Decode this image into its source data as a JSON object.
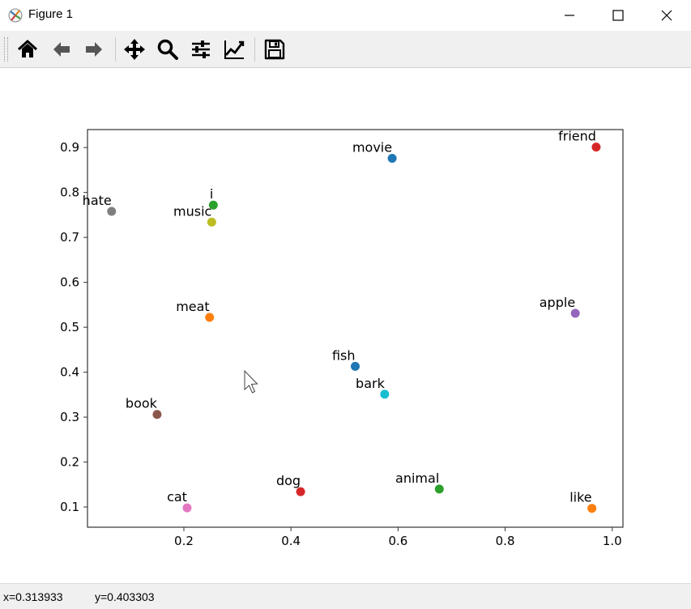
{
  "window": {
    "title": "Figure 1",
    "icons": [
      "figure-app-icon",
      "minimize-icon",
      "maximize-icon",
      "close-icon"
    ]
  },
  "toolbar": {
    "buttons": [
      {
        "name": "home",
        "icon": "home-icon"
      },
      {
        "name": "back",
        "icon": "arrow-left-icon"
      },
      {
        "name": "forward",
        "icon": "arrow-right-icon"
      },
      {
        "name": "pan",
        "icon": "move-icon"
      },
      {
        "name": "zoom",
        "icon": "magnifier-icon"
      },
      {
        "name": "subplots",
        "icon": "sliders-icon"
      },
      {
        "name": "edit-axes",
        "icon": "line-chart-icon"
      },
      {
        "name": "save",
        "icon": "floppy-disk-icon"
      }
    ]
  },
  "status": {
    "x": "x=0.313933",
    "y": "y=0.403303"
  },
  "chart_data": {
    "type": "scatter",
    "title": "",
    "xlabel": "",
    "ylabel": "",
    "xlim": [
      0.02,
      1.02
    ],
    "ylim": [
      0.055,
      0.94
    ],
    "xticks": [
      0.2,
      0.4,
      0.6,
      0.8,
      1.0
    ],
    "xtick_labels": [
      "0.2",
      "0.4",
      "0.6",
      "0.8",
      "1.0"
    ],
    "yticks": [
      0.1,
      0.2,
      0.3,
      0.4,
      0.5,
      0.6,
      0.7,
      0.8,
      0.9
    ],
    "ytick_labels": [
      "0.1",
      "0.2",
      "0.3",
      "0.4",
      "0.5",
      "0.6",
      "0.7",
      "0.8",
      "0.9"
    ],
    "grid": false,
    "points": [
      {
        "label": "movie",
        "x": 0.589,
        "y": 0.876,
        "color": "#1f77b4"
      },
      {
        "label": "friend",
        "x": 0.97,
        "y": 0.901,
        "color": "#d62728"
      },
      {
        "label": "hate",
        "x": 0.065,
        "y": 0.758,
        "color": "#7f7f7f"
      },
      {
        "label": "i",
        "x": 0.255,
        "y": 0.772,
        "color": "#2ca02c"
      },
      {
        "label": "music",
        "x": 0.252,
        "y": 0.734,
        "color": "#bcbd22"
      },
      {
        "label": "meat",
        "x": 0.248,
        "y": 0.522,
        "color": "#ff7f0e"
      },
      {
        "label": "apple",
        "x": 0.931,
        "y": 0.531,
        "color": "#9467bd"
      },
      {
        "label": "fish",
        "x": 0.52,
        "y": 0.413,
        "color": "#1f77b4"
      },
      {
        "label": "bark",
        "x": 0.575,
        "y": 0.351,
        "color": "#17becf"
      },
      {
        "label": "book",
        "x": 0.15,
        "y": 0.306,
        "color": "#8c564b"
      },
      {
        "label": "dog",
        "x": 0.418,
        "y": 0.134,
        "color": "#d62728"
      },
      {
        "label": "animal",
        "x": 0.677,
        "y": 0.14,
        "color": "#2ca02c"
      },
      {
        "label": "cat",
        "x": 0.206,
        "y": 0.098,
        "color": "#e377c2"
      },
      {
        "label": "like",
        "x": 0.962,
        "y": 0.097,
        "color": "#ff7f0e"
      }
    ]
  }
}
